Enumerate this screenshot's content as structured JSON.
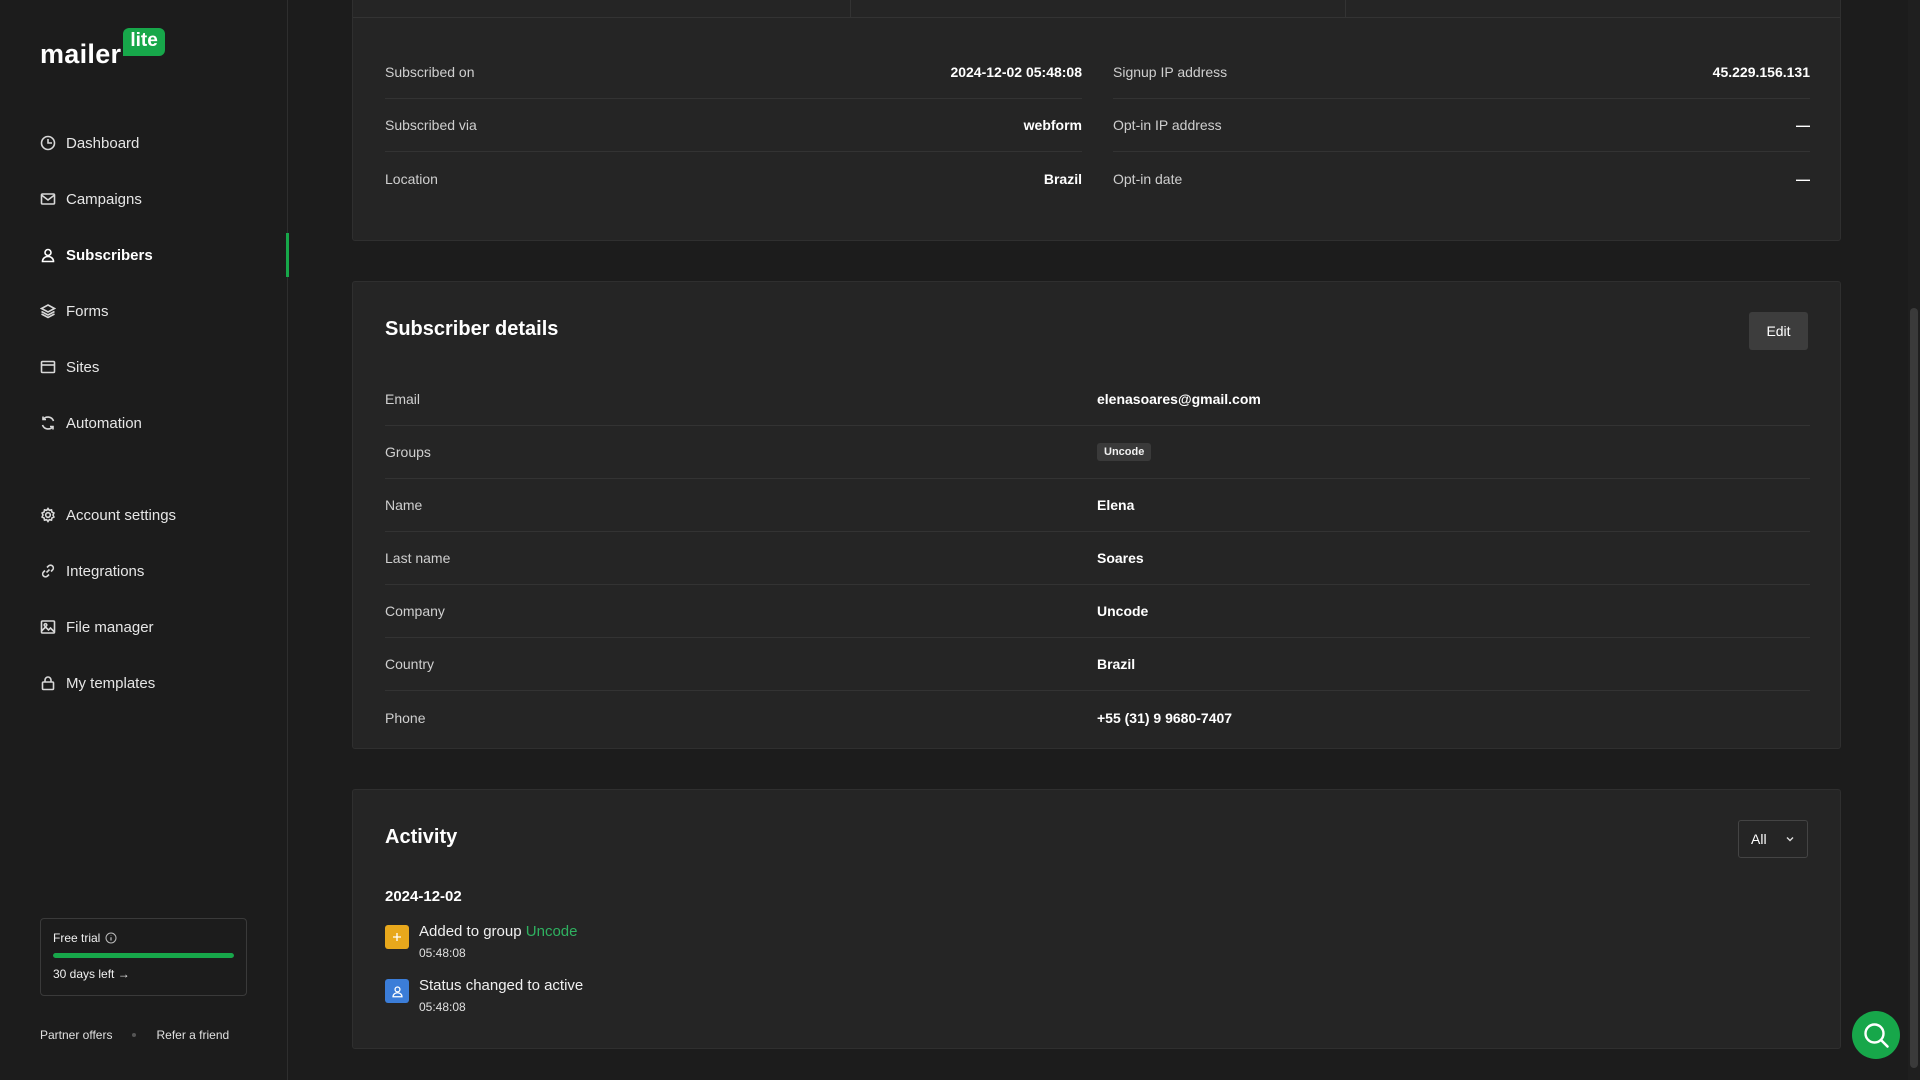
{
  "brand": {
    "word": "mailer",
    "badge": "lite",
    "accent": "#17a74a"
  },
  "sidebar": {
    "items": [
      {
        "label": "Dashboard",
        "icon": "dashboard-icon"
      },
      {
        "label": "Campaigns",
        "icon": "mail-icon"
      },
      {
        "label": "Subscribers",
        "icon": "user-icon",
        "active": true
      },
      {
        "label": "Forms",
        "icon": "layers-icon"
      },
      {
        "label": "Sites",
        "icon": "browser-icon"
      },
      {
        "label": "Automation",
        "icon": "refresh-icon"
      }
    ],
    "secondary": [
      {
        "label": "Account settings",
        "icon": "gear-icon"
      },
      {
        "label": "Integrations",
        "icon": "link-icon"
      },
      {
        "label": "File manager",
        "icon": "image-icon"
      },
      {
        "label": "My templates",
        "icon": "lock-icon"
      }
    ],
    "trial": {
      "title": "Free trial",
      "days_left": "30 days left →",
      "progress": 1.0
    },
    "footer": {
      "partner": "Partner offers",
      "refer": "Refer a friend"
    }
  },
  "meta": {
    "left": [
      {
        "label": "Subscribed on",
        "value": "2024-12-02 05:48:08"
      },
      {
        "label": "Subscribed via",
        "value": "webform"
      },
      {
        "label": "Location",
        "value": "Brazil"
      }
    ],
    "right": [
      {
        "label": "Signup IP address",
        "value": "45.229.156.131"
      },
      {
        "label": "Opt-in IP address",
        "value": "—"
      },
      {
        "label": "Opt-in date",
        "value": "—"
      }
    ]
  },
  "details": {
    "title": "Subscriber details",
    "edit_label": "Edit",
    "rows": [
      {
        "label": "Email",
        "value": "elenasoares@gmail.com"
      },
      {
        "label": "Groups",
        "value": "Uncode"
      },
      {
        "label": "Name",
        "value": "Elena"
      },
      {
        "label": "Last name",
        "value": "Soares"
      },
      {
        "label": "Company",
        "value": "Uncode"
      },
      {
        "label": "Country",
        "value": "Brazil"
      },
      {
        "label": "Phone",
        "value": "+55 (31) 9 9680-7407"
      }
    ]
  },
  "activity": {
    "title": "Activity",
    "filter": "All",
    "date": "2024-12-02",
    "items": [
      {
        "text": "Added to group ",
        "link": "Uncode",
        "time": "05:48:08",
        "icon": "plus-icon",
        "color": "#e8a81c"
      },
      {
        "text": "Status changed to active",
        "time": "05:48:08",
        "icon": "user-icon",
        "color": "#3b7dd8"
      }
    ]
  }
}
